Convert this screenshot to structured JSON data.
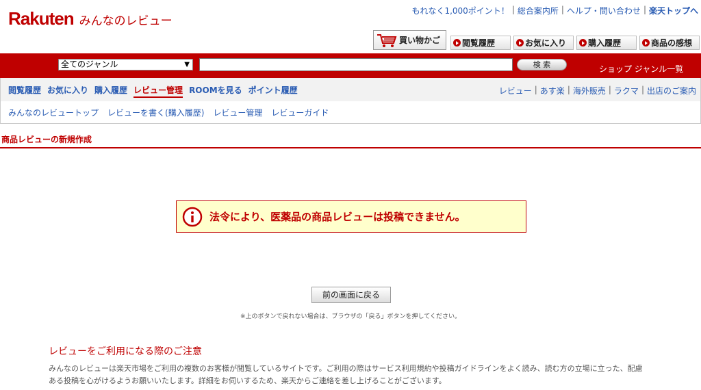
{
  "header": {
    "brand": "Rakuten",
    "subtitle": "みんなのレビュー",
    "toplinks": [
      "もれなく1,000ポイント！",
      "総合案内所",
      "ヘルプ・問い合わせ",
      "楽天トップへ"
    ],
    "cart_label": "買い物かご",
    "nav_buttons": [
      "閲覧履歴",
      "お気に入り",
      "購入履歴",
      "商品の感想"
    ]
  },
  "search": {
    "genre_selected": "全てのジャンル",
    "button_label": "検 索",
    "shop_genre_link": "ショップ ジャンル一覧"
  },
  "subnav": {
    "left": [
      "閲覧履歴",
      "お気に入り",
      "購入履歴",
      "レビュー管理",
      "ROOMを見る",
      "ポイント履歴"
    ],
    "right": [
      "レビュー",
      "あす楽",
      "海外販売",
      "ラクマ",
      "出店のご案内"
    ]
  },
  "subnav2": [
    "みんなのレビュートップ",
    "レビューを書く(購入履歴)",
    "レビュー管理",
    "レビューガイド"
  ],
  "page": {
    "title": "商品レビューの新規作成",
    "notice": "法令により、医薬品の商品レビューは投稿できません。",
    "back_button": "前の画面に戻る",
    "back_note": "※上のボタンで戻れない場合は、ブラウザの「戻る」ボタンを押してください。"
  },
  "caution": {
    "title": "レビューをご利用になる際のご注意",
    "line1": "みんなのレビューは楽天市場をご利用の複数のお客様が閲覧しているサイトです。ご利用の際はサービス利用規約や投稿ガイドラインをよく読み、読む方の立場に立った、配慮",
    "line2": "ある投稿を心がけるようお願いいたします。詳細をお伺いするため、楽天からご連絡を差し上げることがございます。"
  },
  "colors": {
    "brand_red": "#bf0000",
    "link_blue": "#2a5cb3",
    "notice_bg": "#ffffcc"
  }
}
